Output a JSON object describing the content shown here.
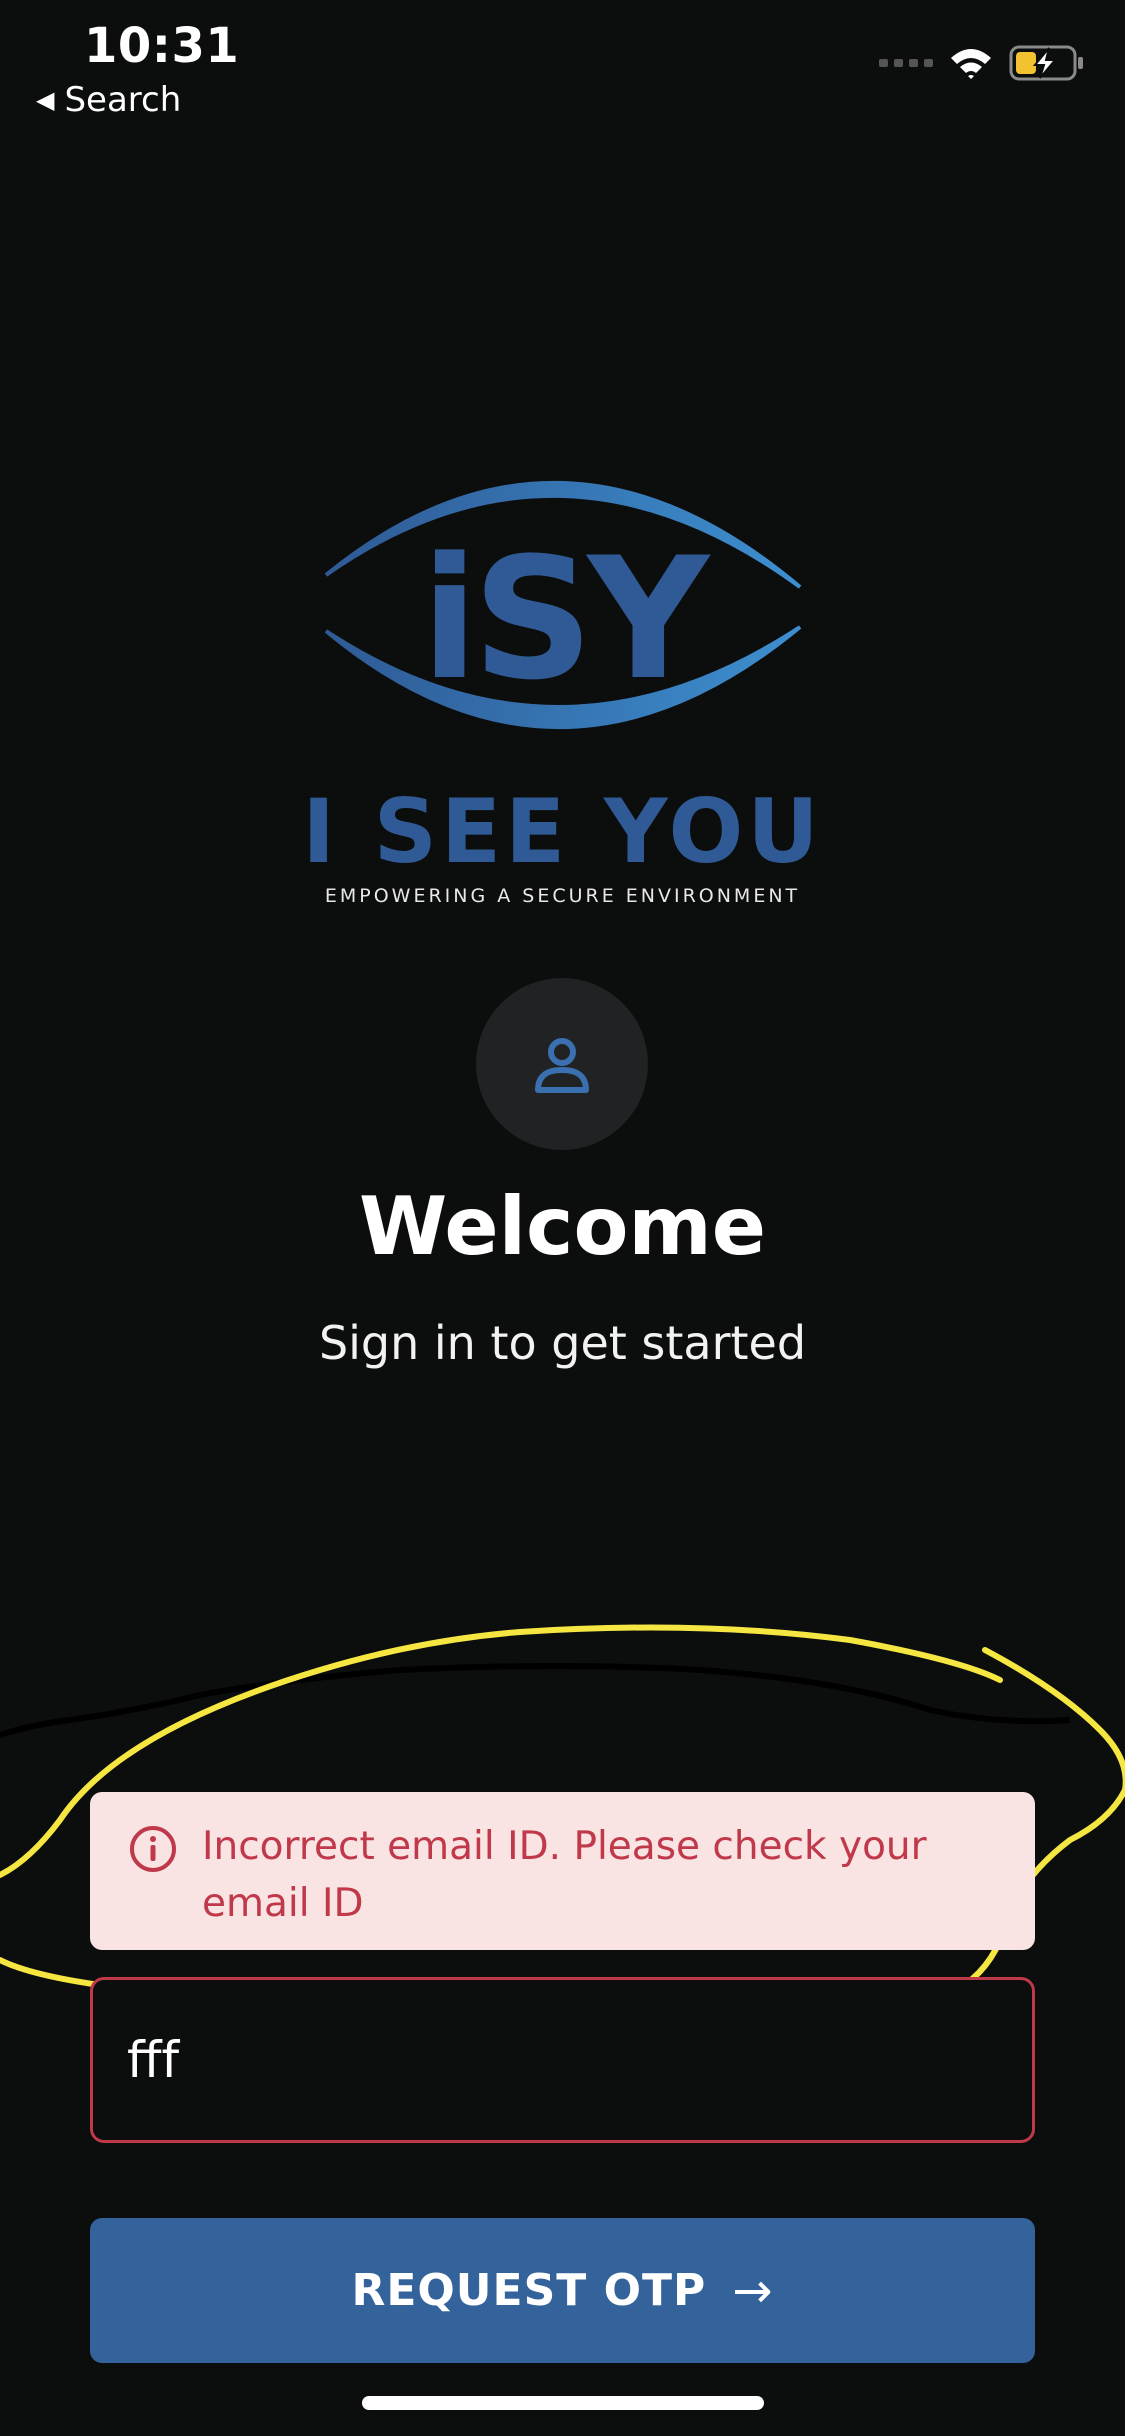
{
  "status_bar": {
    "time": "10:31",
    "back_label": "Search",
    "icons": [
      "cellular-signal-icon",
      "wifi-icon",
      "battery-charging-icon"
    ]
  },
  "logo": {
    "mark_text": "iSY",
    "brand_name": "I SEE YOU",
    "tagline": "EMPOWERING A SECURE ENVIRONMENT",
    "colors": {
      "primary": "#2f5a95",
      "accent": "#3d8fd0"
    }
  },
  "avatar": {
    "icon": "user-icon"
  },
  "welcome": {
    "title": "Welcome",
    "subtitle": "Sign in to get started"
  },
  "error": {
    "icon": "info-icon",
    "message": "Incorrect email ID. Please check your email ID",
    "color": "#c0394b",
    "background": "#f9e3e3"
  },
  "email_field": {
    "value": "fff",
    "border_color": "#c0394b"
  },
  "request_button": {
    "label": "REQUEST OTP",
    "arrow": "→",
    "color": "#33639a"
  },
  "annotation": {
    "color": "#f5e642"
  }
}
